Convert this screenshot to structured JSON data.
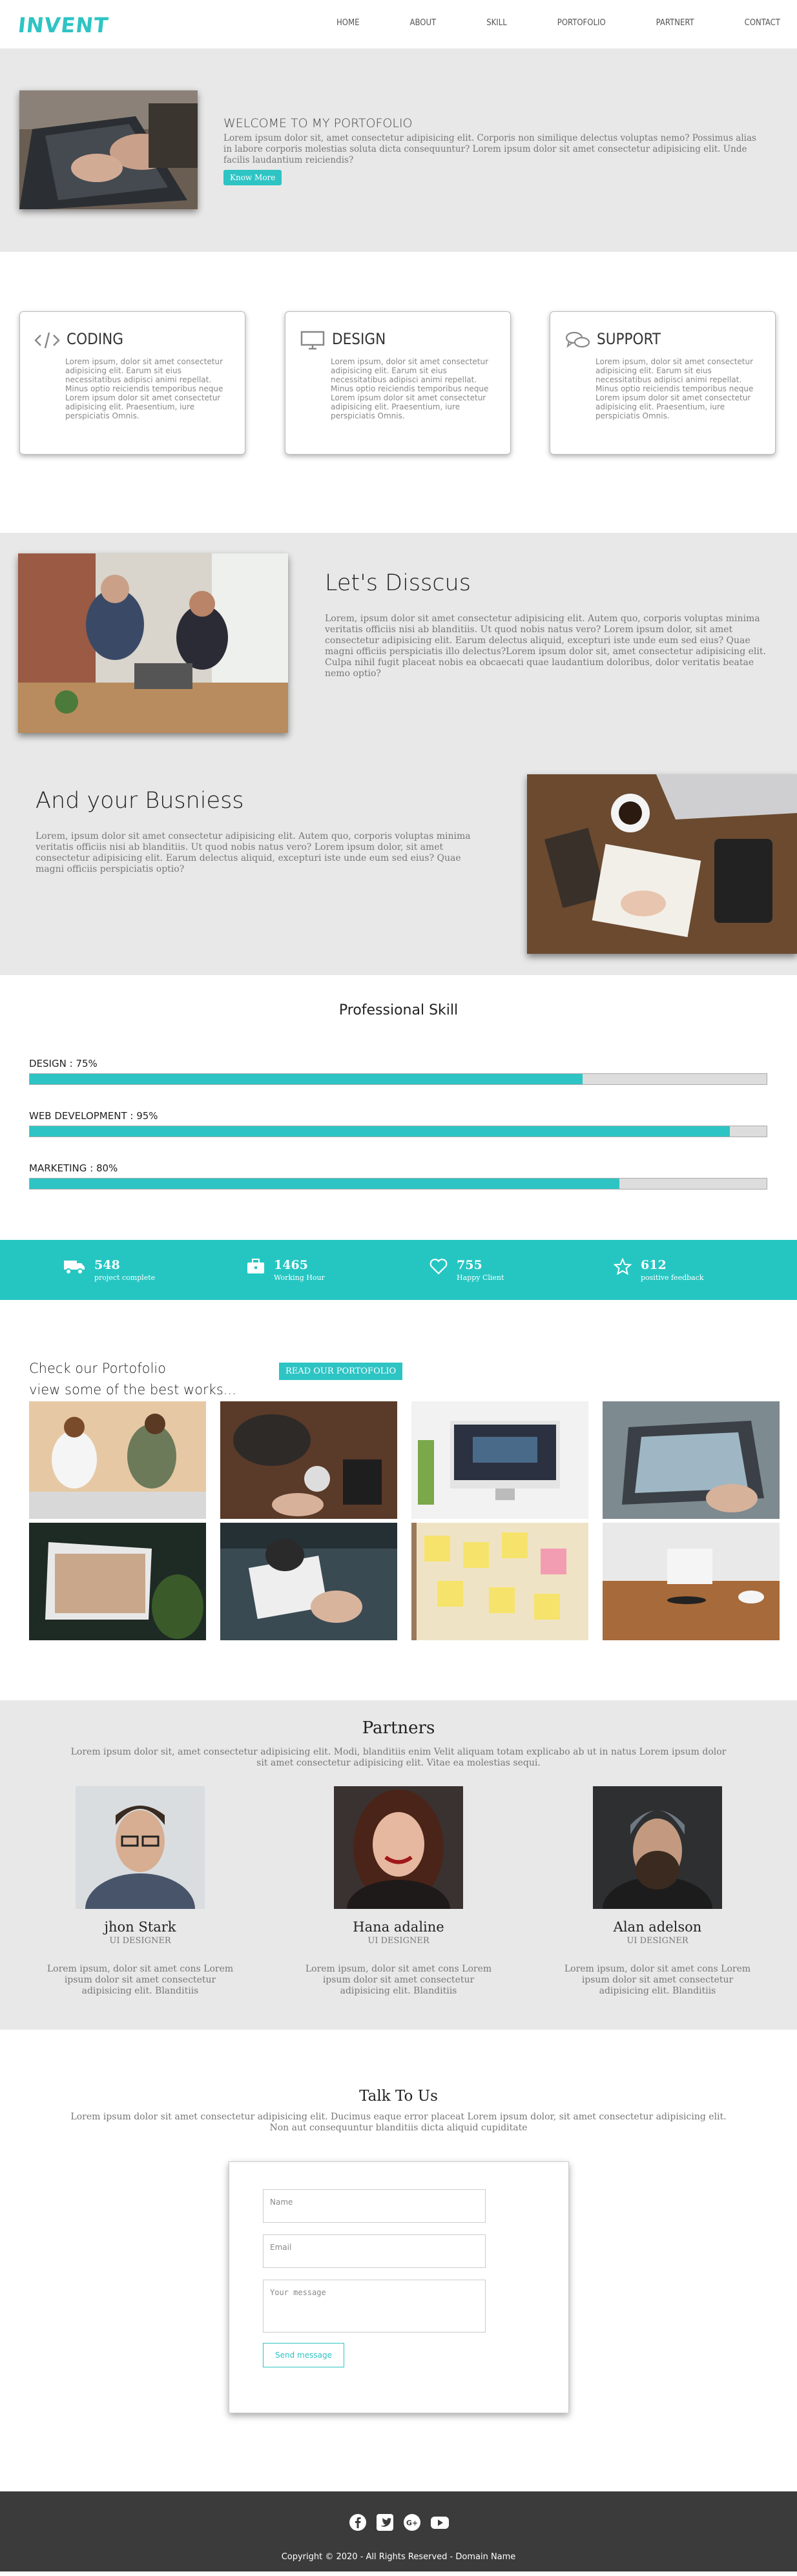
{
  "nav": {
    "logo": "INVENT",
    "links": [
      "HOME",
      "ABOUT",
      "SKILL",
      "PORTOFOLIO",
      "PARTNERT",
      "CONTACT"
    ]
  },
  "hero": {
    "title": "WELCOME TO MY PORTOFOLIO",
    "body": "Lorem ipsum dolor sit, amet consectetur adipisicing elit. Corporis non similique delectus voluptas nemo? Possimus alias in labore corporis molestias soluta dicta consequuntur? Lorem ipsum dolor sit amet consectetur adipisicing elit. Unde facilis laudantium reiciendis?",
    "button": "Know More"
  },
  "services": [
    {
      "title": "CODING",
      "icon": "code-icon",
      "body": "Lorem ipsum, dolor sit amet consectetur adipisicing elit. Earum sit eius necessitatibus adipisci animi repellat. Minus optio reiciendis temporibus neque Lorem ipsum dolor sit amet consectetur adipisicing elit. Praesentium, iure perspiciatis Omnis."
    },
    {
      "title": "DESIGN",
      "icon": "monitor-icon",
      "body": "Lorem ipsum, dolor sit amet consectetur adipisicing elit. Earum sit eius necessitatibus adipisci animi repellat. Minus optio reiciendis temporibus neque Lorem ipsum dolor sit amet consectetur adipisicing elit. Praesentium, iure perspiciatis Omnis."
    },
    {
      "title": "SUPPORT",
      "icon": "chat-icon",
      "body": "Lorem ipsum, dolor sit amet consectetur adipisicing elit. Earum sit eius necessitatibus adipisci animi repellat. Minus optio reiciendis temporibus neque Lorem ipsum dolor sit amet consectetur adipisicing elit. Praesentium, iure perspiciatis Omnis."
    }
  ],
  "discuss": {
    "title": "Let's Disscus",
    "body": "Lorem, ipsum dolor sit amet consectetur adipisicing elit. Autem quo, corporis voluptas minima veritatis officiis nisi ab blanditiis. Ut quod nobis natus vero? Lorem ipsum dolor, sit amet consectetur adipisicing elit. Earum delectus aliquid, excepturi iste unde eum sed eius? Quae magni officiis perspiciatis illo delectus?Lorem ipsum dolor sit, amet consectetur adipisicing elit. Culpa nihil fugit placeat nobis ea obcaecati quae laudantium doloribus, dolor veritatis beatae nemo optio?"
  },
  "business": {
    "title": "And your Busniess",
    "body": "Lorem, ipsum dolor sit amet consectetur adipisicing elit. Autem quo, corporis voluptas minima veritatis officiis nisi ab blanditiis. Ut quod nobis natus vero? Lorem ipsum dolor, sit amet consectetur adipisicing elit. Earum delectus aliquid, excepturi iste unde eum sed eius? Quae magni officiis perspiciatis optio?"
  },
  "skills": {
    "title": "Professional Skill",
    "items": [
      {
        "label": "DESIGN : 75%",
        "level": 0.75
      },
      {
        "label": "WEB DEVELOPMENT : 95%",
        "level": 0.95
      },
      {
        "label": "MARKETING : 80%",
        "level": 0.8
      }
    ]
  },
  "stats": [
    {
      "icon": "truck-icon",
      "num": "548",
      "label": "project complete"
    },
    {
      "icon": "briefcase-icon",
      "num": "1465",
      "label": "Working Hour"
    },
    {
      "icon": "heart-icon",
      "num": "755",
      "label": "Happy Client"
    },
    {
      "icon": "star-icon",
      "num": "612",
      "label": "positive feedback"
    }
  ],
  "portfolio": {
    "title_line1": "Check our Portofolio",
    "title_line2": "view some of the best works...",
    "button": "READ OUR PORTOFOLIO"
  },
  "partners": {
    "title": "Partners",
    "subtitle": "Lorem ipsum dolor sit, amet consectetur adipisicing elit. Modi, blanditiis enim Velit aliquam totam explicabo ab ut in natus Lorem ipsum dolor sit amet consectetur adipisicing elit. Vitae ea molestias sequi.",
    "people": [
      {
        "name": "jhon Stark",
        "role": "UI DESIGNER",
        "body": "Lorem ipsum, dolor sit amet cons Lorem ipsum dolor sit amet consectetur adipisicing elit. Blanditiis"
      },
      {
        "name": "Hana adaline",
        "role": "UI DESIGNER",
        "body": "Lorem ipsum, dolor sit amet cons Lorem ipsum dolor sit amet consectetur adipisicing elit. Blanditiis"
      },
      {
        "name": "Alan adelson",
        "role": "UI DESIGNER",
        "body": "Lorem ipsum, dolor sit amet cons Lorem ipsum dolor sit amet consectetur adipisicing elit. Blanditiis"
      }
    ]
  },
  "contact": {
    "title": "Talk To Us",
    "subtitle": "Lorem ipsum dolor sit amet consectetur adipisicing elit. Ducimus eaque error placeat Lorem ipsum dolor, sit amet consectetur adipisicing elit. Non aut consequuntur blanditiis dicta aliquid cupiditate",
    "name_placeholder": "Name",
    "email_placeholder": "Email",
    "message_placeholder": "Your message",
    "send": "Send message"
  },
  "footer": {
    "socials": [
      "facebook-icon",
      "twitter-icon",
      "google-plus-icon",
      "youtube-icon"
    ],
    "copyright": "Copyright © 2020 - All Rights Reserved - Domain Name"
  },
  "colors": {
    "accent": "#2ec4c4",
    "stats_bg": "#25c6c2",
    "section_gray": "#e8e8e8",
    "footer": "#3b3b3b"
  }
}
